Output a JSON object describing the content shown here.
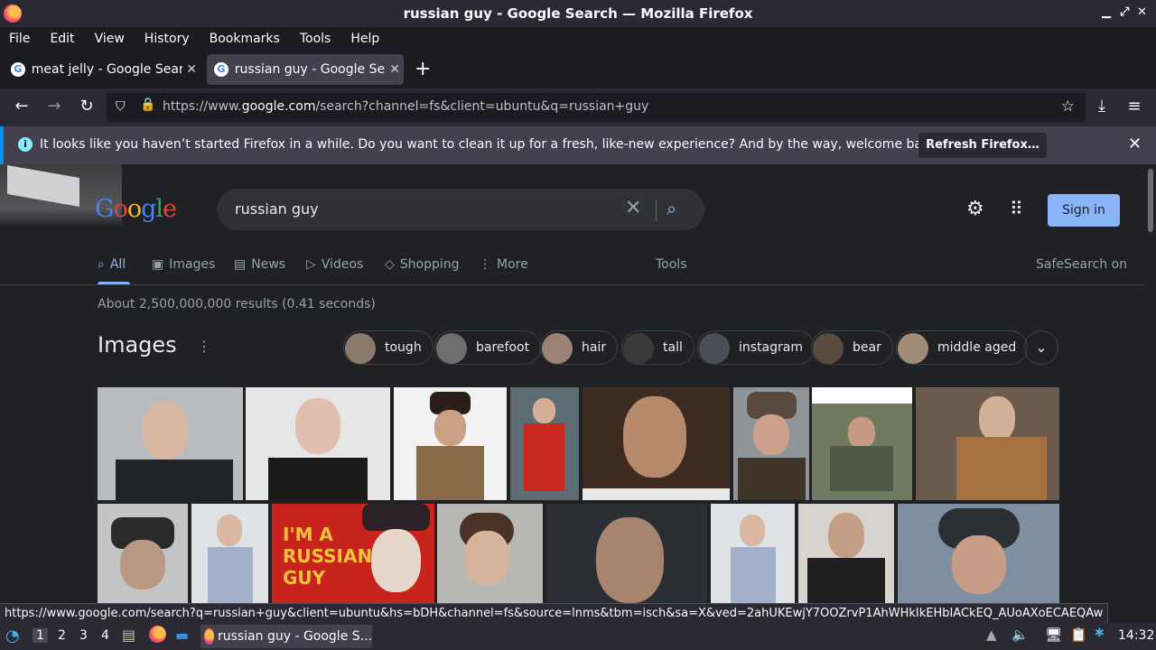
{
  "window": {
    "title": "russian guy - Google Search — Mozilla Firefox",
    "min": "▁",
    "max": "⤢",
    "close": "✕"
  },
  "menu": [
    "File",
    "Edit",
    "View",
    "History",
    "Bookmarks",
    "Tools",
    "Help"
  ],
  "tabs": [
    {
      "label": "meat jelly - Google Search",
      "active": false
    },
    {
      "label": "russian guy - Google Search",
      "active": true
    }
  ],
  "tab_close": "✕",
  "new_tab": "+",
  "nav": {
    "back": "←",
    "forward": "→",
    "reload": "↻",
    "url_prefix": "https://www.",
    "url_domain": "google.com",
    "url_rest": "/search?channel=fs&client=ubuntu&q=russian+guy",
    "star": "☆",
    "download": "⤓",
    "menu": "≡"
  },
  "notification": {
    "text": "It looks like you haven’t started Firefox in a while. Do you want to clean it up for a fresh, like-new experience? And by the way, welcome back!",
    "button": "Refresh Firefox…",
    "close": "✕",
    "info": "i"
  },
  "google": {
    "logo": "Google",
    "query": "russian guy",
    "clear_icon": "✕",
    "search_icon": "⌕",
    "gear_icon": "⚙",
    "apps_icon": "⋮⋮",
    "signin": "Sign in"
  },
  "search_tabs": [
    {
      "icon": "⌕",
      "label": "All",
      "active": true
    },
    {
      "icon": "▣",
      "label": "Images"
    },
    {
      "icon": "▤",
      "label": "News"
    },
    {
      "icon": "▷",
      "label": "Videos"
    },
    {
      "icon": "◇",
      "label": "Shopping"
    },
    {
      "icon": "⋮",
      "label": "More"
    }
  ],
  "tools": "Tools",
  "safesearch": "SafeSearch on",
  "results_count": "About 2,500,000,000 results (0.41 seconds)",
  "images_section": {
    "title": "Images",
    "menu_icon": "⋮",
    "chips": [
      "tough",
      "barefoot",
      "hair",
      "tall",
      "instagram",
      "bear",
      "middle aged"
    ],
    "expand_icon": "⌄"
  },
  "status_url": "https://www.google.com/search?q=russian+guy&client=ubuntu&hs=bDH&channel=fs&source=lnms&tbm=isch&sa=X&ved=2ahUKEwjY7OOZrvP1AhWHkIkEHbIACkEQ_AUoAXoECAEQAw",
  "taskbar": {
    "workspaces": [
      "1",
      "2",
      "3",
      "4"
    ],
    "app_label": "russian guy - Google S...",
    "clock": "14:32"
  }
}
